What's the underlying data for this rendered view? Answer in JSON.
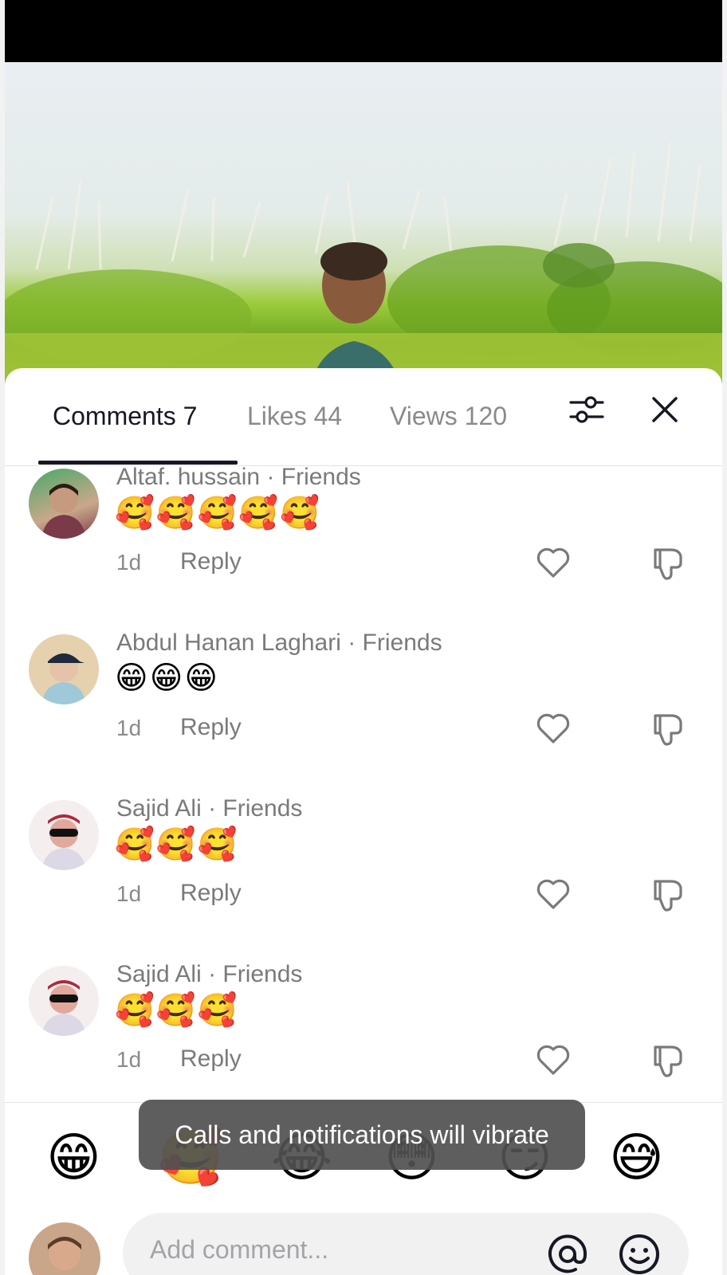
{
  "tabs": {
    "comments": "Comments 7",
    "likes": "Likes 44",
    "views": "Views 120"
  },
  "comments": [
    {
      "name": "Altaf. hussain · Friends",
      "text": "🥰🥰🥰🥰🥰",
      "time": "1d",
      "reply": "Reply"
    },
    {
      "name": "Abdul Hanan Laghari · Friends",
      "text": "😁😁😁",
      "time": "1d",
      "reply": "Reply"
    },
    {
      "name": "Sajid Ali · Friends",
      "text": "🥰🥰🥰",
      "time": "1d",
      "reply": "Reply"
    },
    {
      "name": "Sajid Ali · Friends",
      "text": "🥰🥰🥰",
      "time": "1d",
      "reply": "Reply"
    }
  ],
  "emoji_bar": [
    "😁",
    "🥰",
    "😂",
    "😳",
    "😏",
    "😅"
  ],
  "toast": "Calls and notifications will vibrate",
  "composer": {
    "placeholder": "Add comment..."
  },
  "icons": [
    "filter-sliders-icon",
    "close-icon",
    "heart-icon",
    "dislike-icon",
    "at-icon",
    "emoji-icon"
  ]
}
